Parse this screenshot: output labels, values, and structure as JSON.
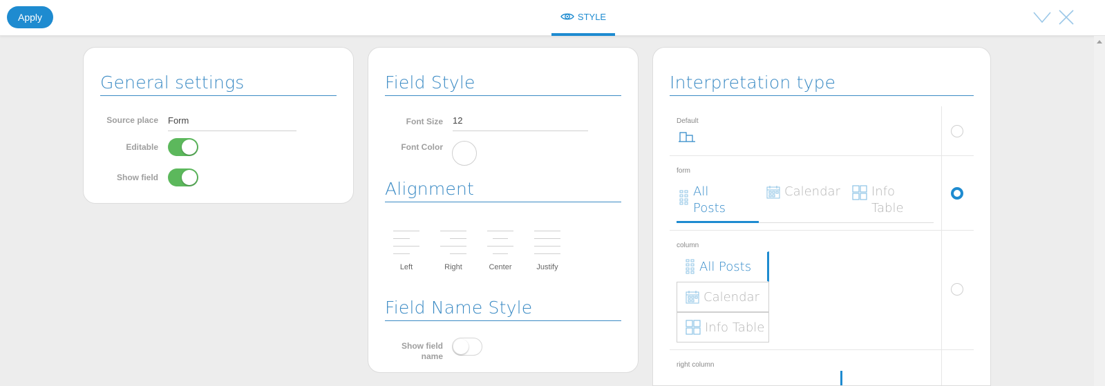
{
  "header": {
    "apply_label": "Apply",
    "tab_label": "STYLE",
    "icons": {
      "tab": "eye-icon",
      "collapse": "chevron-down-icon",
      "close": "close-icon"
    }
  },
  "general": {
    "title": "General settings",
    "source_label": "Source place",
    "source_value": "Form",
    "editable_label": "Editable",
    "editable_on": true,
    "show_field_label": "Show field",
    "show_field_on": true
  },
  "field_style": {
    "title": "Field Style",
    "font_size_label": "Font Size",
    "font_size_value": "12",
    "font_color_label": "Font Color",
    "alignment_title": "Alignment",
    "align": {
      "left": "Left",
      "right": "Right",
      "center": "Center",
      "justify": "Justify"
    },
    "field_name_title": "Field Name Style",
    "show_field_name_label_1": "Show field",
    "show_field_name_label_2": "name",
    "show_field_name_on": false
  },
  "interpretation": {
    "title": "Interpretation type",
    "default_label": "Default",
    "form_label": "form",
    "column_label": "column",
    "right_column_label": "right column",
    "tabs": {
      "all_posts_1": "All",
      "all_posts_2": "Posts",
      "calendar": "Calendar",
      "info_table_1": "Info",
      "info_table_2": "Table",
      "all_posts": "All Posts",
      "info_table": "Info Table"
    },
    "selected": "form",
    "accent": "#1e8bd0"
  }
}
